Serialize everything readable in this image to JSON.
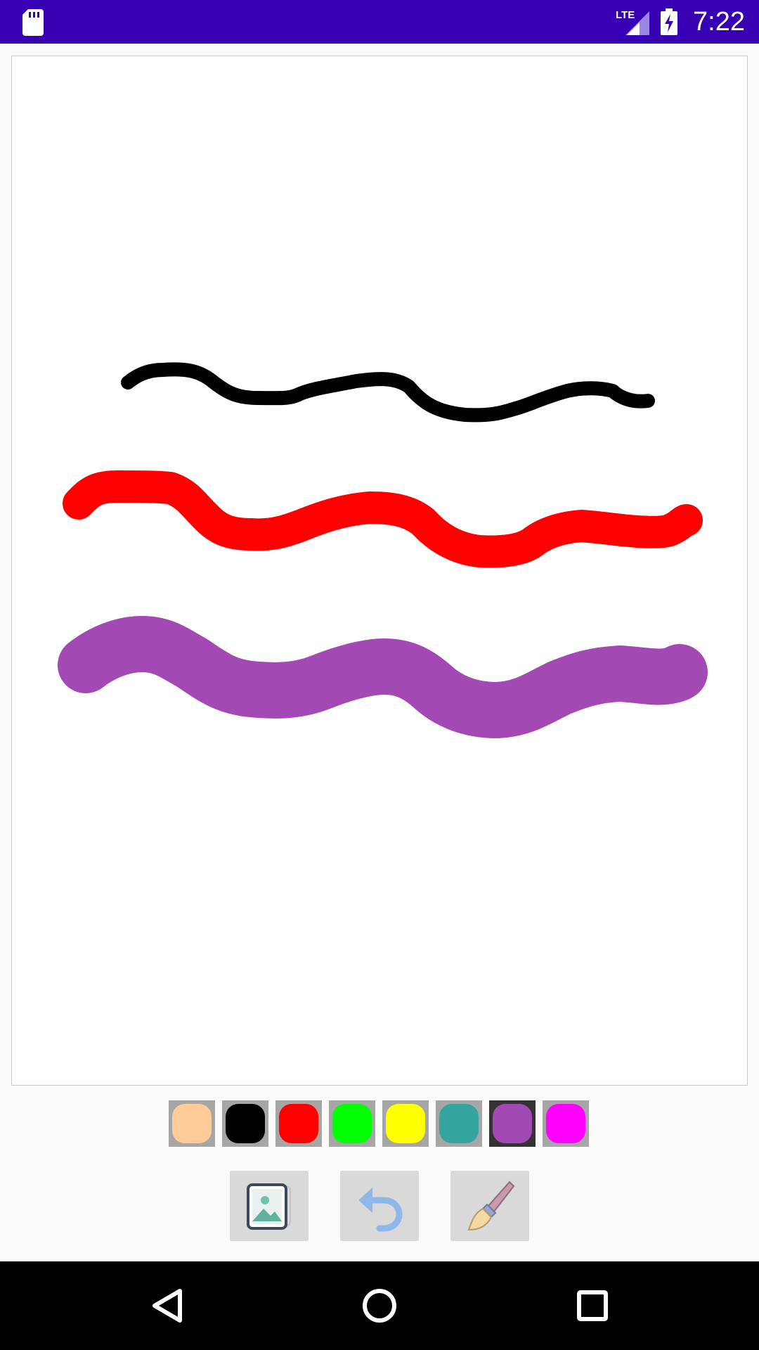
{
  "status_bar": {
    "time": "7:22",
    "network": "LTE",
    "background": "#3700b3"
  },
  "drawing": {
    "strokes": [
      {
        "color": "#000000",
        "name": "black"
      },
      {
        "color": "#ff0000",
        "name": "red"
      },
      {
        "color": "#a349b4",
        "name": "purple"
      }
    ]
  },
  "palette": {
    "colors": [
      "#ffcc99",
      "#000000",
      "#ff0000",
      "#00ff00",
      "#ffff00",
      "#33a59e",
      "#a349b4",
      "#ff00ff"
    ],
    "selected_index": 6
  },
  "toolbar": {
    "icons": [
      "gallery-icon",
      "undo-icon",
      "brush-icon"
    ]
  },
  "nav": {
    "icons": [
      "back-icon",
      "home-icon",
      "recents-icon"
    ]
  }
}
